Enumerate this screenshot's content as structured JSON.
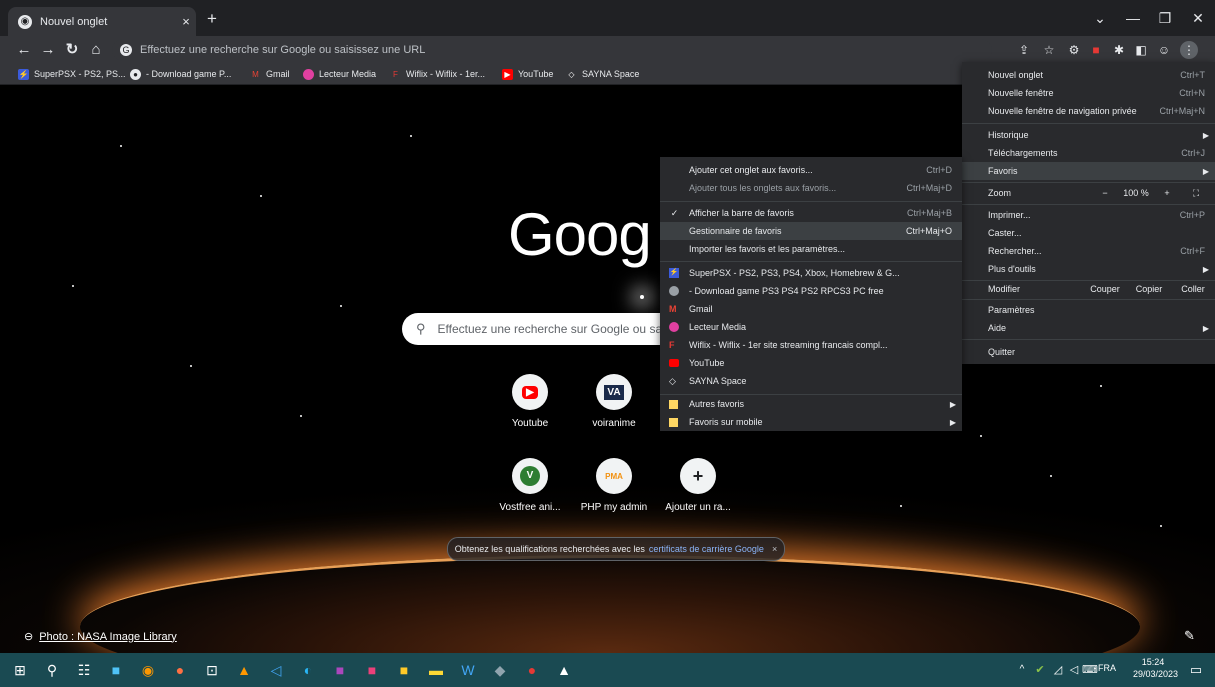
{
  "tab": {
    "title": "Nouvel onglet",
    "close": "×",
    "new": "+"
  },
  "window": {
    "minimize": "—",
    "restore": "❐",
    "close": "✕",
    "dropdown": "⌄"
  },
  "omnibox": {
    "placeholder": "Effectuez une recherche sur Google ou saisissez une URL"
  },
  "bookmarks": [
    {
      "label": "SuperPSX - PS2, PS...",
      "icon": "superpsx-icon",
      "color": "#3b5bdb",
      "glyph": "⚡"
    },
    {
      "label": "- Download game P...",
      "icon": "download-game-icon",
      "color": "#e8eaed",
      "glyph": "●"
    },
    {
      "label": "Gmail",
      "icon": "gmail-icon",
      "color": "#ea4335",
      "glyph": "M"
    },
    {
      "label": "Lecteur Media",
      "icon": "lecteur-media-icon",
      "color": "#e040a0",
      "glyph": "●"
    },
    {
      "label": "Wiflix - Wiflix - 1er...",
      "icon": "wiflix-icon",
      "color": "#e53935",
      "glyph": "F"
    },
    {
      "label": "YouTube",
      "icon": "youtube-icon",
      "color": "#ff0000",
      "glyph": "▶"
    },
    {
      "label": "SAYNA Space",
      "icon": "sayna-icon",
      "color": "#35363a",
      "glyph": "◇"
    }
  ],
  "ntp": {
    "logo": "Goog",
    "search_text": "Effectuez une recherche sur Google ou sa",
    "shortcuts": [
      {
        "label": "Youtube",
        "glyph": "▶",
        "color": "#ff0000"
      },
      {
        "label": "voiranime",
        "glyph": "VA",
        "color": "#1a2a4a"
      },
      {
        "label": "Vostfree ani...",
        "glyph": "V",
        "color": "#2e7d32"
      },
      {
        "label": "PHP my admin",
        "glyph": "PMA",
        "color": "#f29111"
      },
      {
        "label": "Ajouter un ra...",
        "glyph": "+",
        "color": "#202124"
      }
    ],
    "promo_text": "Obtenez les qualifications recherchées avec les",
    "promo_link": "certificats de carrière Google",
    "promo_close": "×",
    "photo_credit": "Photo : NASA Image Library"
  },
  "main_menu": {
    "items": [
      {
        "label": "Nouvel onglet",
        "shortcut": "Ctrl+T"
      },
      {
        "label": "Nouvelle fenêtre",
        "shortcut": "Ctrl+N"
      },
      {
        "label": "Nouvelle fenêtre de navigation privée",
        "shortcut": "Ctrl+Maj+N"
      },
      {
        "label": "Historique",
        "shortcut": ""
      },
      {
        "label": "Téléchargements",
        "shortcut": "Ctrl+J"
      },
      {
        "label": "Favoris",
        "shortcut": ""
      },
      {
        "label": "Zoom",
        "shortcut": ""
      },
      {
        "label": "Imprimer...",
        "shortcut": "Ctrl+P"
      },
      {
        "label": "Caster...",
        "shortcut": ""
      },
      {
        "label": "Rechercher...",
        "shortcut": "Ctrl+F"
      },
      {
        "label": "Plus d'outils",
        "shortcut": ""
      },
      {
        "label": "Modifier",
        "shortcut": ""
      },
      {
        "label": "Paramètres",
        "shortcut": ""
      },
      {
        "label": "Aide",
        "shortcut": ""
      },
      {
        "label": "Quitter",
        "shortcut": ""
      }
    ],
    "zoom": {
      "minus": "−",
      "value": "100 %",
      "plus": "+",
      "fullscreen": "⛶"
    },
    "edit": {
      "cut": "Couper",
      "copy": "Copier",
      "paste": "Coller"
    }
  },
  "favoris_menu": {
    "items": [
      {
        "label": "Ajouter cet onglet aux favoris...",
        "shortcut": "Ctrl+D"
      },
      {
        "label": "Ajouter tous les onglets aux favoris...",
        "shortcut": "Ctrl+Maj+D"
      },
      {
        "label": "Afficher la barre de favoris",
        "shortcut": "Ctrl+Maj+B",
        "check": "✓"
      },
      {
        "label": "Gestionnaire de favoris",
        "shortcut": "Ctrl+Maj+O"
      },
      {
        "label": "Importer les favoris et les paramètres...",
        "shortcut": ""
      }
    ],
    "bookmarks": [
      {
        "label": "SuperPSX - PS2, PS3, PS4, Xbox, Homebrew & G...",
        "color": "#3b5bdb",
        "glyph": "⚡"
      },
      {
        "label": "- Download game PS3 PS4 PS2 RPCS3 PC free",
        "color": "#9aa0a6",
        "glyph": "●"
      },
      {
        "label": "Gmail",
        "color": "#ea4335",
        "glyph": "M"
      },
      {
        "label": "Lecteur Media",
        "color": "#e040a0",
        "glyph": "●"
      },
      {
        "label": "Wiflix - Wiflix - 1er site streaming francais compl...",
        "color": "#e53935",
        "glyph": "F"
      },
      {
        "label": "YouTube",
        "color": "#ff0000",
        "glyph": "▶"
      },
      {
        "label": "SAYNA Space",
        "color": "#292a2d",
        "glyph": "◇"
      }
    ],
    "folders": [
      {
        "label": "Autres favoris"
      },
      {
        "label": "Favoris sur mobile"
      }
    ]
  },
  "taskbar": {
    "lang": "FRA",
    "time": "15:24",
    "date": "29/03/2023"
  }
}
